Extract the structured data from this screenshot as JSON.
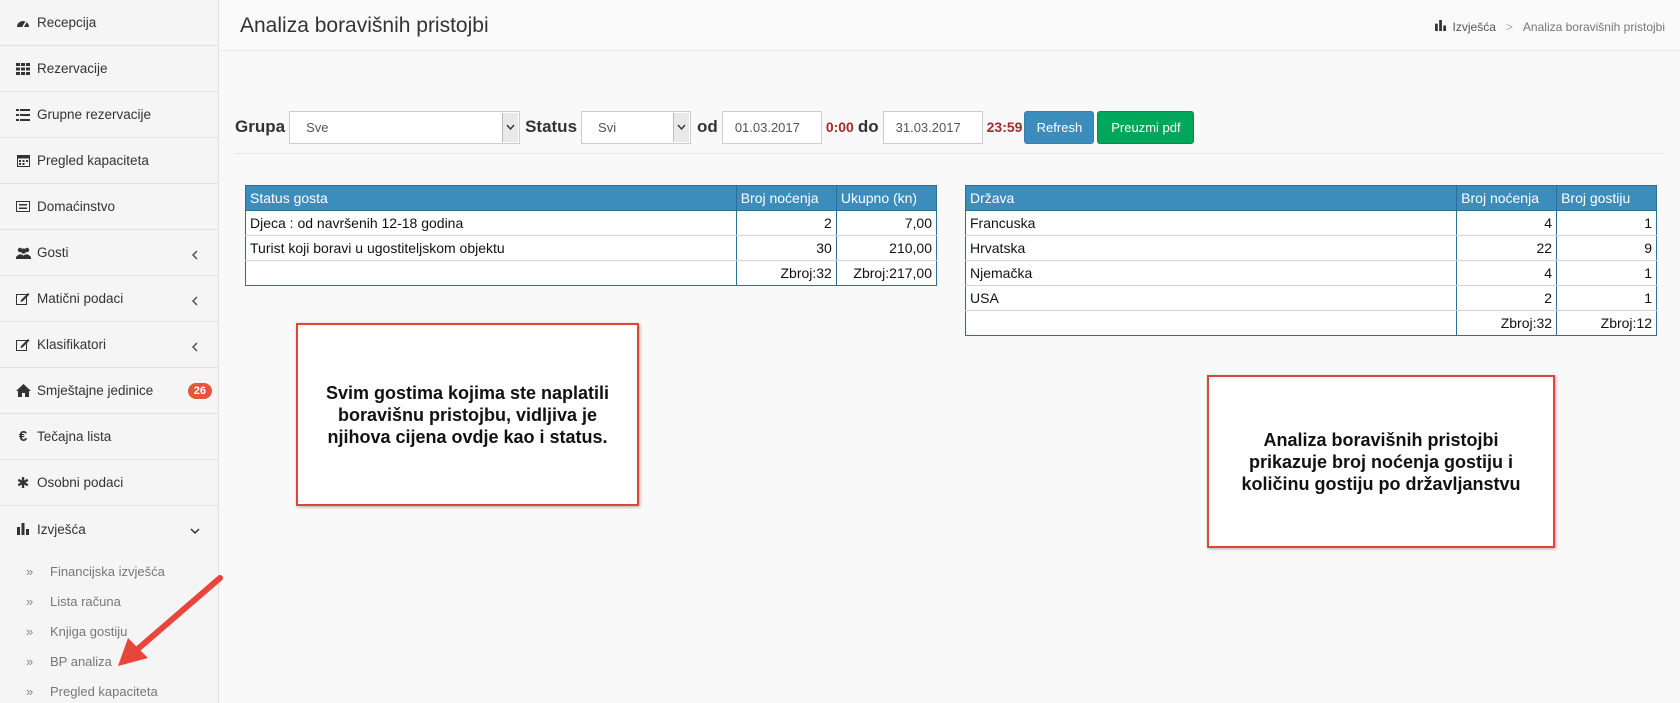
{
  "sidebar": {
    "items": [
      {
        "label": "Recepcija",
        "icon": "dashboard-icon"
      },
      {
        "label": "Rezervacije",
        "icon": "grid-icon"
      },
      {
        "label": "Grupne rezervacije",
        "icon": "list-icon"
      },
      {
        "label": "Pregled kapaciteta",
        "icon": "calendar-icon"
      },
      {
        "label": "Domaćinstvo",
        "icon": "card-icon"
      },
      {
        "label": "Gosti",
        "icon": "users-icon"
      },
      {
        "label": "Matični podaci",
        "icon": "edit-icon"
      },
      {
        "label": "Klasifikatori",
        "icon": "edit-icon"
      },
      {
        "label": "Smještajne jedinice",
        "icon": "home-icon",
        "badge": "26"
      },
      {
        "label": "Tečajna lista",
        "icon": "euro-icon"
      },
      {
        "label": "Osobni podaci",
        "icon": "asterisk-icon"
      },
      {
        "label": "Izvješća",
        "icon": "bar-chart-icon"
      }
    ],
    "subitems": [
      "Financijska izvješća",
      "Lista računa",
      "Knjiga gostiju",
      "BP analiza",
      "Pregled kapaciteta"
    ]
  },
  "header": {
    "title": "Analiza boravišnih pristojbi",
    "breadcrumb": {
      "root": "Izvješća",
      "sep": ">",
      "current": "Analiza boravišnih pristojbi"
    }
  },
  "filters": {
    "grupa_label": "Grupa",
    "grupa_value": "Sve",
    "status_label": "Status",
    "status_value": "Svi",
    "od_label": "od",
    "date_from": "01.03.2017",
    "time_from": "0:00",
    "do_label": "do",
    "date_to": "31.03.2017",
    "time_to": "23:59",
    "refresh_label": "Refresh",
    "pdf_label": "Preuzmi pdf"
  },
  "table_status": {
    "headers": [
      "Status gosta",
      "Broj noćenja",
      "Ukupno (kn)"
    ],
    "rows": [
      [
        "Djeca : od navršenih 12-18 godina",
        "2",
        "7,00"
      ],
      [
        "Turist koji boravi u ugostiteljskom objektu",
        "30",
        "210,00"
      ],
      [
        "",
        "Zbroj:32",
        "Zbroj:217,00"
      ]
    ]
  },
  "table_country": {
    "headers": [
      "Država",
      "Broj noćenja",
      "Broj gostiju"
    ],
    "rows": [
      [
        "Francuska",
        "4",
        "1"
      ],
      [
        "Hrvatska",
        "22",
        "9"
      ],
      [
        "Njemačka",
        "4",
        "1"
      ],
      [
        "USA",
        "2",
        "1"
      ],
      [
        "",
        "Zbroj:32",
        "Zbroj:12"
      ]
    ]
  },
  "callouts": {
    "left": "Svim gostima kojima ste naplatili boravišnu pristojbu, vidljiva je njihova cijena ovdje kao i status.",
    "right": "Analiza boravišnih pristojbi prikazuje broj noćenja gostiju i količinu gostiju po državljanstvu"
  },
  "colors": {
    "accent": "#3c8dbc",
    "success": "#00a65a",
    "badge": "#e8553e",
    "callout_border": "#e0453a",
    "time": "#a52a2a"
  }
}
